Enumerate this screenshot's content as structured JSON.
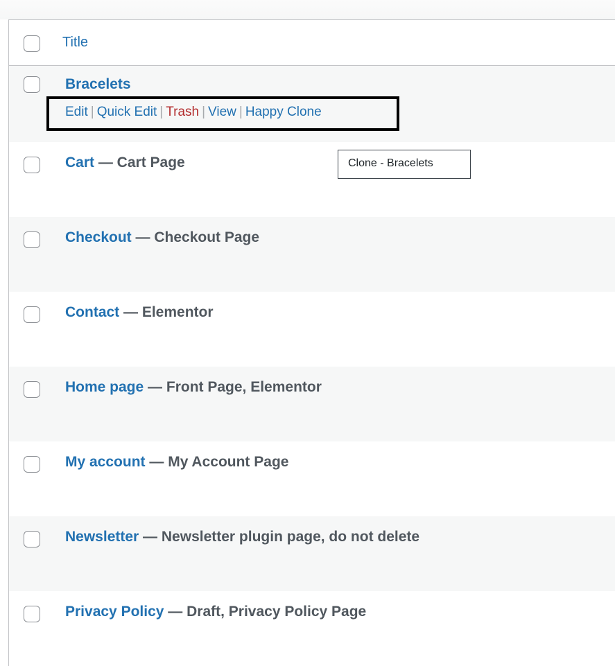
{
  "table": {
    "header": {
      "title_label": "Title"
    },
    "rows": [
      {
        "title": "Bracelets",
        "state": ""
      },
      {
        "title": "Cart",
        "state": " — Cart Page"
      },
      {
        "title": "Checkout",
        "state": " — Checkout Page"
      },
      {
        "title": "Contact",
        "state": " — Elementor"
      },
      {
        "title": "Home page",
        "state": " — Front Page, Elementor"
      },
      {
        "title": "My account",
        "state": " — My Account Page"
      },
      {
        "title": "Newsletter",
        "state": " — Newsletter plugin page, do not delete"
      },
      {
        "title": "Privacy Policy",
        "state": " — Draft, Privacy Policy Page"
      }
    ],
    "row_actions": {
      "edit": "Edit",
      "quick_edit": "Quick Edit",
      "trash": "Trash",
      "view": "View",
      "happy_clone": "Happy Clone",
      "separator": "|"
    }
  },
  "tooltip": {
    "text": "Clone - Bracelets"
  },
  "colors": {
    "link": "#2271b1",
    "trash": "#b32d2e",
    "row_alt": "#f6f7f7",
    "highlight_border": "#000000"
  }
}
